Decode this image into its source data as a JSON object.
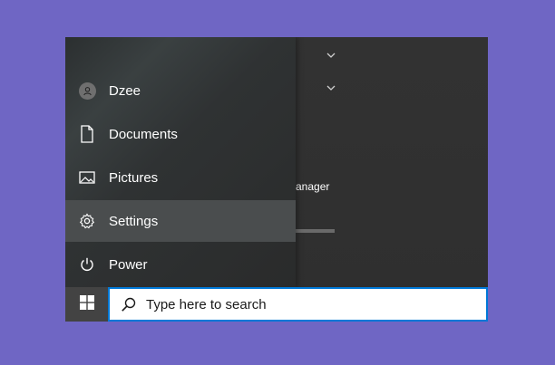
{
  "start_menu": {
    "items": [
      {
        "label": "Dzee",
        "icon": "user-avatar-icon"
      },
      {
        "label": "Documents",
        "icon": "document-icon"
      },
      {
        "label": "Pictures",
        "icon": "picture-icon"
      },
      {
        "label": "Settings",
        "icon": "gear-icon",
        "active": true
      },
      {
        "label": "Power",
        "icon": "power-icon"
      }
    ]
  },
  "tiles": {
    "partial_label": "anager"
  },
  "taskbar": {
    "start_icon": "windows-logo-icon",
    "search": {
      "placeholder": "Type here to search",
      "icon": "search-icon"
    }
  },
  "colors": {
    "desktop_background": "#6f66c4",
    "accent": "#0078d7",
    "active_item": "#4a4d4e"
  }
}
